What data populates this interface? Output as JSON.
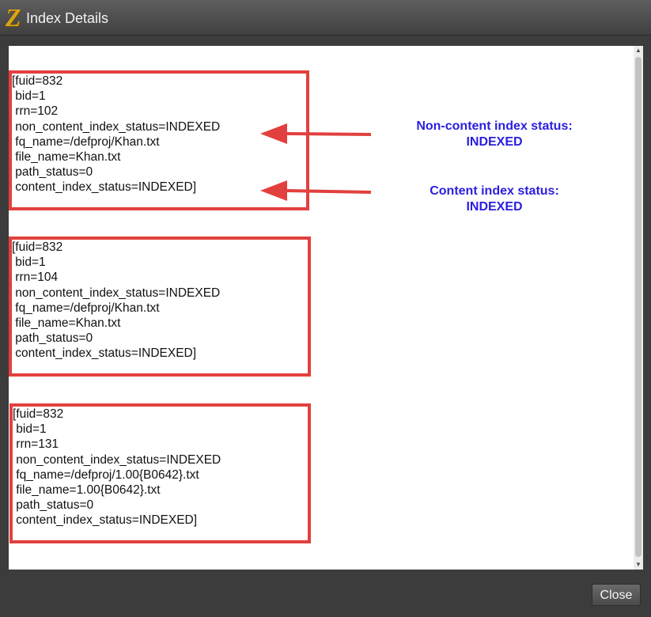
{
  "window": {
    "title": "Index Details"
  },
  "records": [
    {
      "lines": [
        "[fuid=832",
        " bid=1",
        " rrn=102",
        " non_content_index_status=INDEXED",
        " fq_name=/defproj/Khan.txt",
        " file_name=Khan.txt",
        " path_status=0",
        " content_index_status=INDEXED]"
      ]
    },
    {
      "lines": [
        "[fuid=832",
        " bid=1",
        " rrn=104",
        " non_content_index_status=INDEXED",
        " fq_name=/defproj/Khan.txt",
        " file_name=Khan.txt",
        " path_status=0",
        " content_index_status=INDEXED]"
      ]
    },
    {
      "lines": [
        "[fuid=832",
        " bid=1",
        " rrn=131",
        " non_content_index_status=INDEXED",
        " fq_name=/defproj/1.00{B0642}.txt",
        " file_name=1.00{B0642}.txt",
        " path_status=0",
        " content_index_status=INDEXED]"
      ]
    }
  ],
  "annotations": {
    "non_content": {
      "line1": "Non-content index status:",
      "line2": "INDEXED"
    },
    "content": {
      "line1": "Content index status:",
      "line2": "INDEXED"
    }
  },
  "colors": {
    "box_border": "#e2403e",
    "annotation_text": "#2a1ee0",
    "arrow": "#e2403e"
  },
  "footer": {
    "close_label": "Close"
  }
}
